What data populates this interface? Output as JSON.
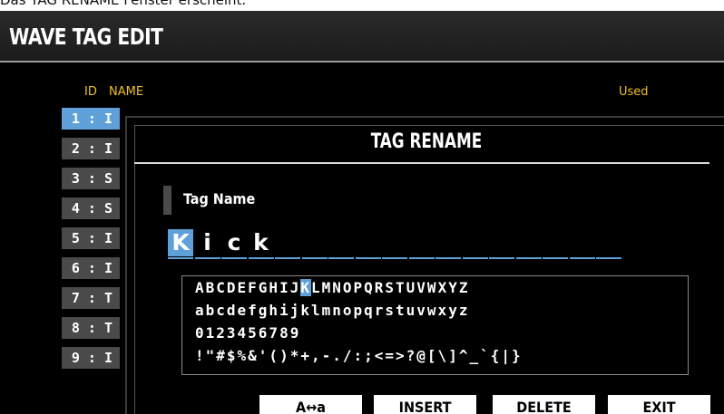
{
  "caption": "Das TAG RENAME Fenster erscheint.",
  "header": {
    "title": "WAVE TAG EDIT"
  },
  "list": {
    "col_id": "ID",
    "col_name": "NAME",
    "col_used": "Used",
    "rows": [
      "1 : I",
      "2 : I",
      "3 : S",
      "4 : S",
      "5 : I",
      "6 : I",
      "7 : T",
      "8 : T",
      "9 : I"
    ],
    "selected_index": 0
  },
  "dialog": {
    "title": "TAG RENAME",
    "field_label": "Tag Name",
    "name_chars": [
      "K",
      "i",
      "c",
      "k",
      "",
      "",
      "",
      "",
      "",
      "",
      "",
      "",
      "",
      "",
      "",
      "",
      ""
    ],
    "cursor_index": 0,
    "charmap": {
      "rows": [
        "ABCDEFGHIJKLMNOPQRSTUVWXYZ",
        "abcdefghijklmnopqrstuvwxyz",
        "0123456789",
        "!\"#$%&'()*+,-./:;<=>?@[\\]^_`{|}"
      ],
      "row0_before": "ABCDEFGHIJ",
      "row0_selected": "K",
      "row0_after": "LMNOPQRSTUVWXYZ"
    },
    "buttons": {
      "case_toggle": "A↔a",
      "insert": "INSERT",
      "delete": "DELETE",
      "exit": "EXIT"
    }
  },
  "colors": {
    "accent": "#5fa0d8",
    "header_yellow": "#f0c020",
    "row_gray": "#4a4a4a"
  }
}
